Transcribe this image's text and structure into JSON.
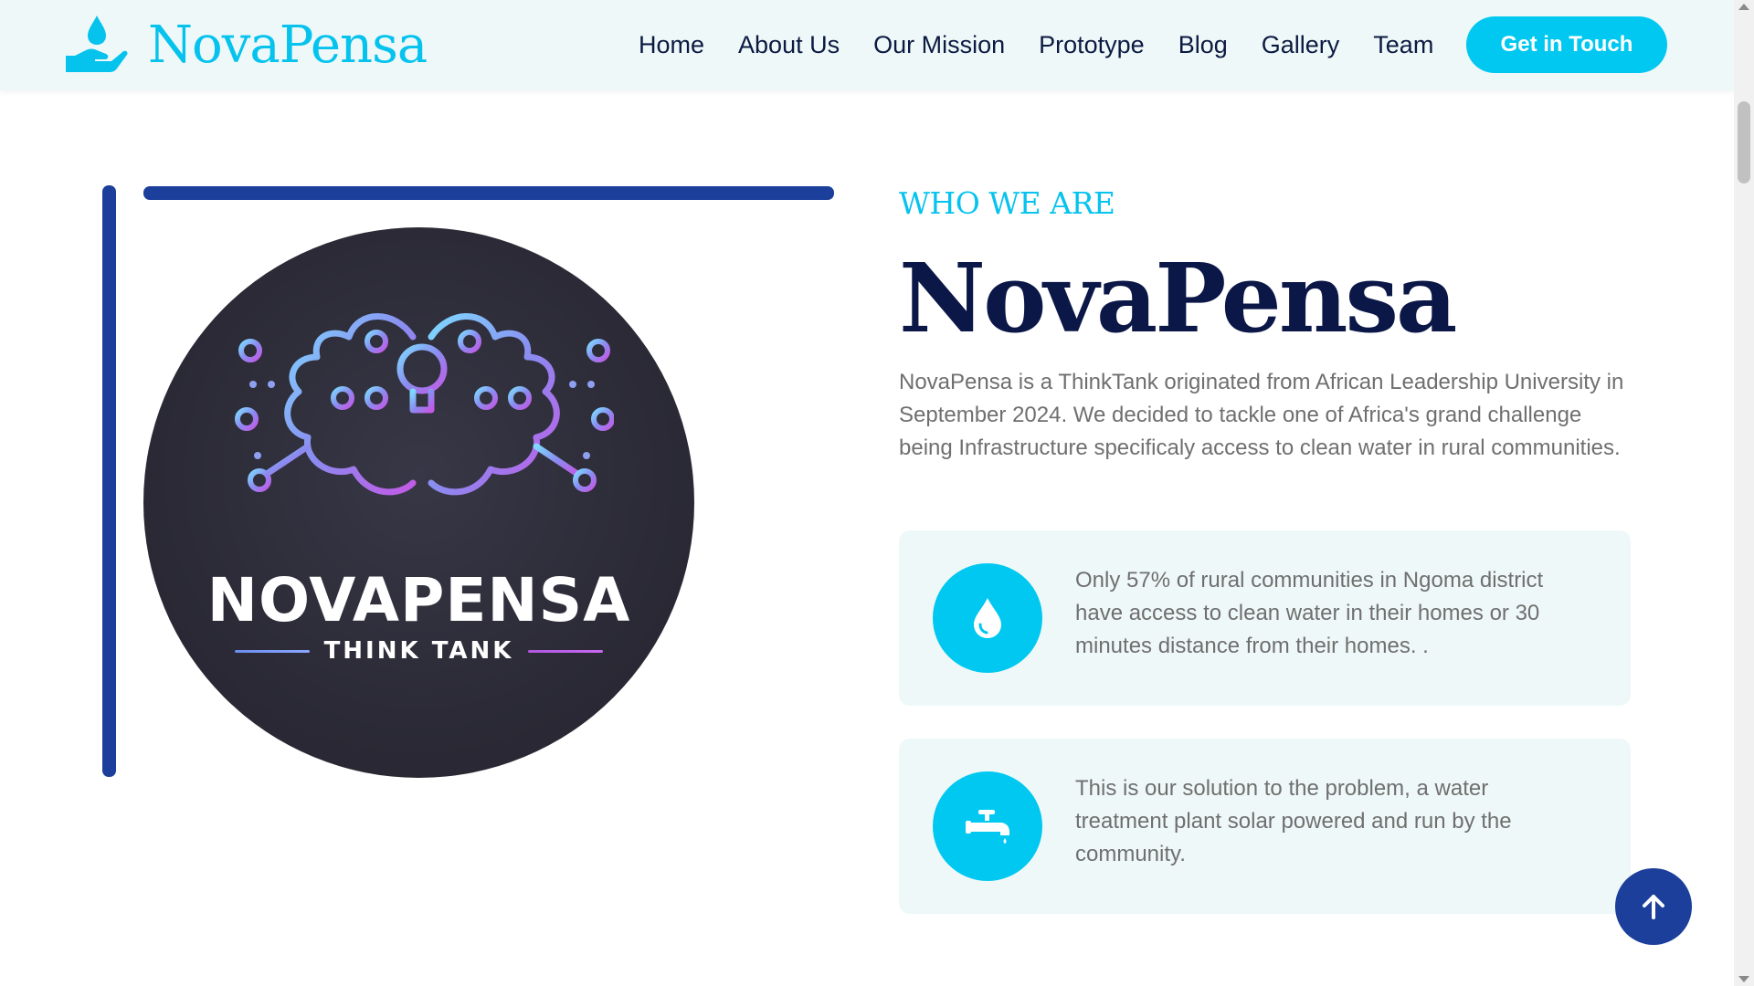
{
  "header": {
    "brand_name": "NovaPensa",
    "brand_icon": "hand-with-water-drop-icon",
    "nav": [
      {
        "label": "Home"
      },
      {
        "label": "About Us"
      },
      {
        "label": "Our Mission"
      },
      {
        "label": "Prototype"
      },
      {
        "label": "Blog"
      },
      {
        "label": "Gallery"
      },
      {
        "label": "Team"
      }
    ],
    "cta_label": "Get in Touch"
  },
  "about": {
    "logo_image": {
      "title": "NOVAPENSA",
      "subtitle": "THINK TANK",
      "icon": "circuit-brain-lightbulb-icon"
    },
    "eyebrow": "WHO WE ARE",
    "headline": "NovaPensa",
    "intro": "NovaPensa is a ThinkTank originated from African Leadership University in September 2024. We decided to tackle one of Africa's grand challenge being Infrastructure specificaly access to clean water in rural communities.",
    "features": [
      {
        "icon": "water-drop-icon",
        "text": "Only 57% of rural communities in Ngoma district have access to clean water in their homes or 30 minutes distance from their homes. ."
      },
      {
        "icon": "water-tap-icon",
        "text": "This is our solution to the problem, a water treatment plant solar powered and run by the community."
      }
    ]
  },
  "back_to_top_icon": "arrow-up-icon",
  "colors": {
    "accent": "#00c8f0",
    "brand_blue": "#1b3f9a",
    "heading_navy": "#0b1747",
    "nav_bg": "#eff8f8",
    "body_text": "#6f6f6f"
  }
}
